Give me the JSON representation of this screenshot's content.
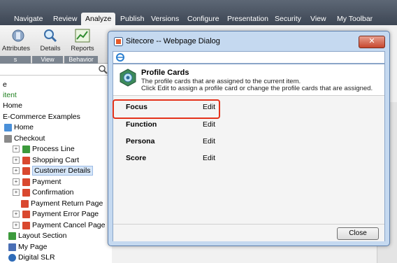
{
  "menubar": {
    "items": [
      "Navigate",
      "Review",
      "Analyze",
      "Publish",
      "Versions",
      "Configure",
      "Presentation",
      "Security",
      "View",
      "My Toolbar"
    ]
  },
  "ribbon": {
    "buttons": [
      "Attributes",
      "Details",
      "Reports"
    ],
    "groups": [
      "s",
      "View",
      "Behavior"
    ]
  },
  "tree": {
    "items": [
      {
        "label": "e",
        "color": "normal"
      },
      {
        "label": "itent",
        "color": "green"
      },
      {
        "label": "Home",
        "color": "normal"
      },
      {
        "label": "E-Commerce Examples",
        "color": "normal"
      },
      {
        "label": "Home",
        "color": "normal"
      },
      {
        "label": "Checkout",
        "color": "normal"
      },
      {
        "label": "Process Line",
        "color": "normal"
      },
      {
        "label": "Shopping Cart",
        "color": "normal"
      },
      {
        "label": "Customer Details",
        "color": "normal"
      },
      {
        "label": "Payment",
        "color": "normal"
      },
      {
        "label": "Confirmation",
        "color": "normal"
      },
      {
        "label": "Payment Return Page",
        "color": "normal"
      },
      {
        "label": "Payment Error Page",
        "color": "normal"
      },
      {
        "label": "Payment Cancel Page",
        "color": "normal"
      },
      {
        "label": "Layout Section",
        "color": "normal"
      },
      {
        "label": "My Page",
        "color": "normal"
      },
      {
        "label": "Digital SLR",
        "color": "normal"
      }
    ]
  },
  "dialog": {
    "title": "Sitecore -- Webpage Dialog",
    "header_title": "Profile Cards",
    "header_line1": "The profile cards that are assigned to the current item.",
    "header_line2": "Click Edit to assign a profile card or change the profile cards that are assigned.",
    "rows": [
      {
        "label": "Focus",
        "action": "Edit"
      },
      {
        "label": "Function",
        "action": "Edit"
      },
      {
        "label": "Persona",
        "action": "Edit"
      },
      {
        "label": "Score",
        "action": "Edit"
      }
    ],
    "close_label": "Close"
  },
  "colors": {
    "highlight": "#e4321b",
    "menubar": "#4a5361",
    "dialog_frame": "#c5d9f0"
  }
}
